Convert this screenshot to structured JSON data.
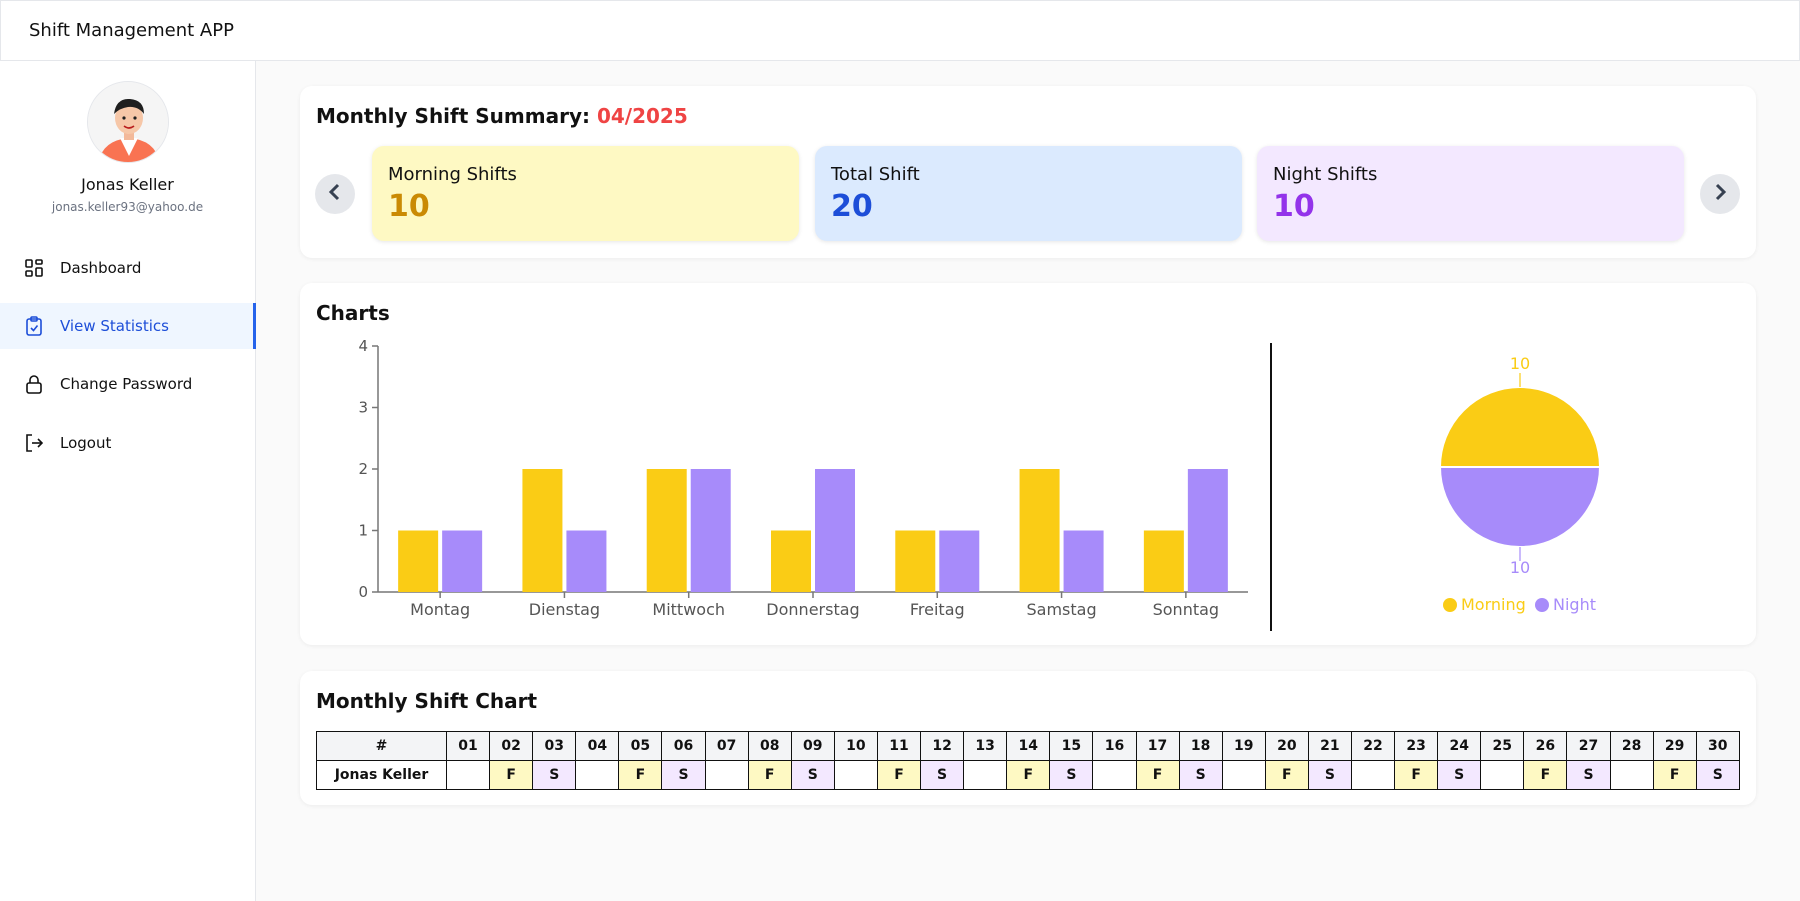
{
  "app": {
    "title": "Shift Management APP"
  },
  "user": {
    "name": "Jonas Keller",
    "email": "jonas.keller93@yahoo.de"
  },
  "sidebar": {
    "items": [
      {
        "label": "Dashboard",
        "icon": "dashboard-icon"
      },
      {
        "label": "View Statistics",
        "icon": "clipboard-check-icon",
        "active": true
      },
      {
        "label": "Change Password",
        "icon": "lock-icon"
      },
      {
        "label": "Logout",
        "icon": "logout-icon"
      }
    ]
  },
  "summary": {
    "title": "Monthly Shift Summary:",
    "month": "04/2025",
    "cards": [
      {
        "label": "Morning Shifts",
        "value": "10",
        "bg": "#fef9c3",
        "color": "#ca8a04"
      },
      {
        "label": "Total Shift",
        "value": "20",
        "bg": "#dbeafe",
        "color": "#1d4ed8"
      },
      {
        "label": "Night Shifts",
        "value": "10",
        "bg": "#f3e8ff",
        "color": "#9333ea"
      }
    ]
  },
  "charts": {
    "title": "Charts"
  },
  "colors": {
    "morning": "#facc15",
    "night": "#a78bfa",
    "morning_text": "#eab308",
    "night_text": "#a78bfa"
  },
  "chart_data": [
    {
      "type": "bar",
      "categories": [
        "Montag",
        "Dienstag",
        "Mittwoch",
        "Donnerstag",
        "Freitag",
        "Samstag",
        "Sonntag"
      ],
      "series": [
        {
          "values": [
            1,
            2,
            2,
            1,
            1,
            2,
            1
          ],
          "color": "#facc15"
        },
        {
          "values": [
            1,
            1,
            2,
            2,
            1,
            1,
            2
          ],
          "color": "#a78bfa"
        }
      ],
      "ylim": [
        0,
        4
      ],
      "yticks": [
        "0",
        "1",
        "2",
        "3",
        "4"
      ],
      "xlabel": "",
      "ylabel": ""
    },
    {
      "type": "pie",
      "slices": [
        {
          "label": "Morning",
          "value": 10,
          "color": "#facc15"
        },
        {
          "label": "Night",
          "value": 10,
          "color": "#a78bfa"
        }
      ],
      "legend": [
        "Morning",
        "Night"
      ]
    }
  ],
  "monthly": {
    "title": "Monthly Shift Chart",
    "corner": "#",
    "days": [
      "01",
      "02",
      "03",
      "04",
      "05",
      "06",
      "07",
      "08",
      "09",
      "10",
      "11",
      "12",
      "13",
      "14",
      "15",
      "16",
      "17",
      "18",
      "19",
      "20",
      "21",
      "22",
      "23",
      "24",
      "25",
      "26",
      "27",
      "28",
      "29",
      "30"
    ],
    "rows": [
      {
        "name": "Jonas Keller",
        "cells": [
          "",
          "F",
          "S",
          "",
          "F",
          "S",
          "",
          "F",
          "S",
          "",
          "F",
          "S",
          "",
          "F",
          "S",
          "",
          "F",
          "S",
          "",
          "F",
          "S",
          "",
          "F",
          "S",
          "",
          "F",
          "S",
          "",
          "F",
          "S"
        ]
      }
    ]
  }
}
